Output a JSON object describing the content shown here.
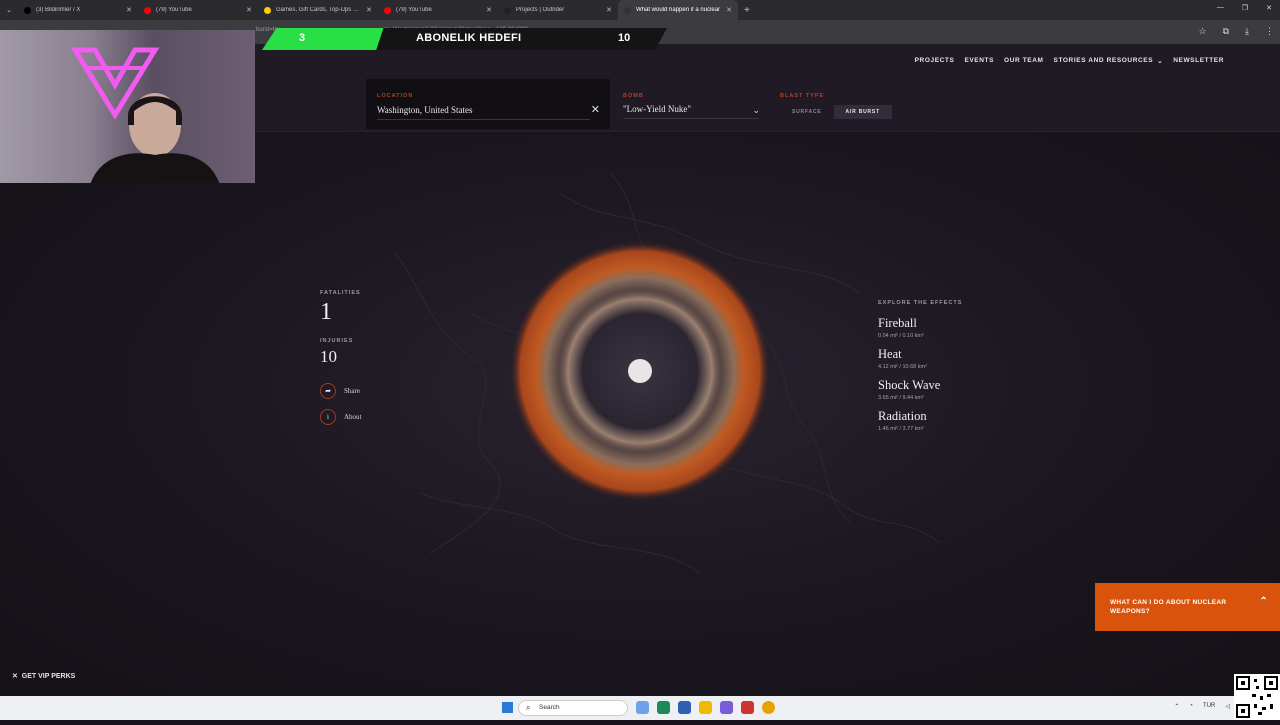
{
  "browser": {
    "tabs": [
      {
        "title": "(3) Bildirimler / X",
        "favicon_color": "#000000",
        "active": false
      },
      {
        "title": "(79) YouTube",
        "favicon_color": "#ff0000",
        "active": false
      },
      {
        "title": "Games, Gift Cards, Top-Ups & More",
        "favicon_color": "#ffcc00",
        "active": false
      },
      {
        "title": "(79) YouTube",
        "favicon_color": "#ff0000",
        "active": false
      },
      {
        "title": "Projects | Outrider",
        "favicon_color": "#222222",
        "active": false
      },
      {
        "title": "What would happen if a nuclear",
        "favicon_color": "#333333",
        "active": true
      }
    ],
    "new_tab": "+",
    "url_left": "burst=tru",
    "url_right": "on=Washington%2C United States&long=-120.094293"
  },
  "stream": {
    "goal_current": "3",
    "goal_title": "ABONELIK HEDEFI",
    "goal_target": "10",
    "goal_progress": 0.3
  },
  "site": {
    "nav": [
      "PROJECTS",
      "EVENTS",
      "OUR TEAM",
      "STORIES AND RESOURCES",
      "NEWSLETTER"
    ],
    "location_label": "LOCATION",
    "location_value": "Washington, United States",
    "bomb_label": "BOMB",
    "bomb_value": "\"Low-Yield Nuke\"",
    "blast_label": "BLAST TYPE",
    "blast_surface": "SURFACE",
    "blast_air": "AIR BURST"
  },
  "stats": {
    "fatalities_label": "FATALITIES",
    "fatalities": "1",
    "injuries_label": "INJURIES",
    "injuries": "10",
    "share": "Share",
    "about": "About"
  },
  "effects": {
    "heading": "EXPLORE THE EFFECTS",
    "items": [
      {
        "name": "Fireball",
        "value": "0.04 mi² / 0.10 km²"
      },
      {
        "name": "Heat",
        "value": "4.12 mi² / 10.68 km²"
      },
      {
        "name": "Shock Wave",
        "value": "3.65 mi² / 9.44 km²"
      },
      {
        "name": "Radiation",
        "value": "1.46 mi² / 3.77 km²"
      }
    ]
  },
  "cta": {
    "text": "WHAT CAN I DO ABOUT NUCLEAR WEAPONS?"
  },
  "vip": "GET VIP PERKS",
  "taskbar": {
    "search_placeholder": "Search",
    "tray_lang": "TUR"
  },
  "colors": {
    "accent_orange": "#d9530c",
    "goal_green": "#28e046",
    "label_red": "#b8421e"
  }
}
